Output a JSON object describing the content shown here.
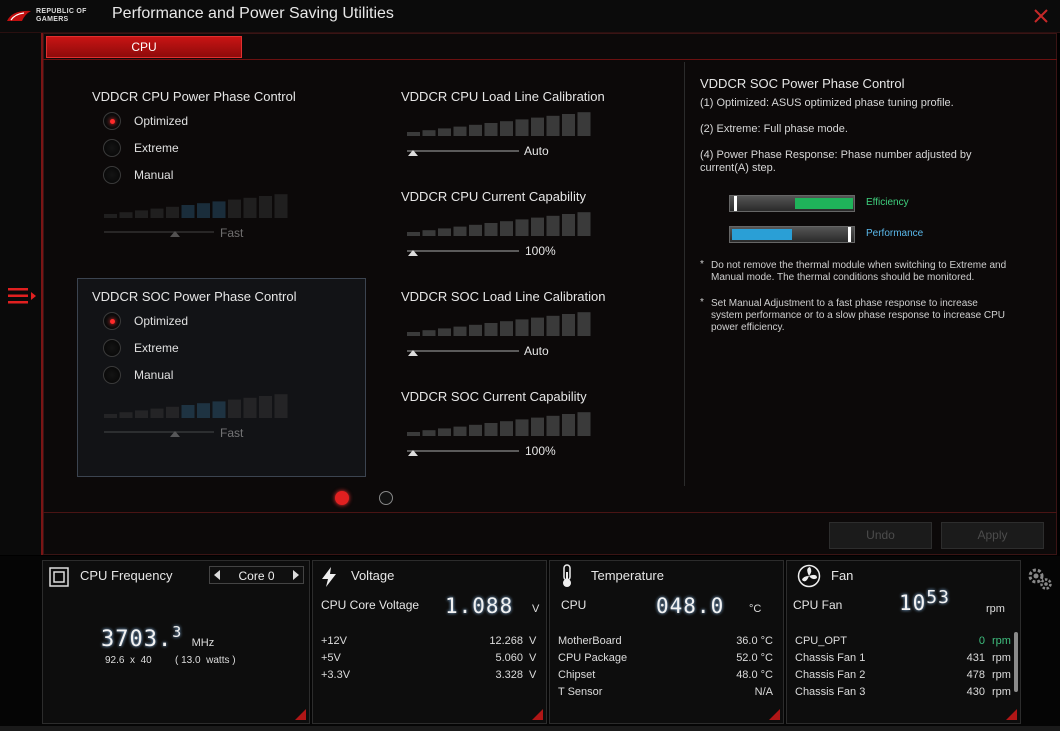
{
  "app": {
    "brand_line1": "REPUBLIC OF",
    "brand_line2": "GAMERS",
    "title": "Performance and Power Saving Utilities"
  },
  "tabs": [
    {
      "label": "CPU"
    }
  ],
  "cpu_phase": {
    "title": "VDDCR CPU Power Phase Control",
    "options": [
      "Optimized",
      "Extreme",
      "Manual"
    ],
    "selected": "Optimized",
    "slider_label": "Fast"
  },
  "soc_phase": {
    "title": "VDDCR SOC Power Phase Control",
    "options": [
      "Optimized",
      "Extreme",
      "Manual"
    ],
    "selected": "Optimized",
    "slider_label": "Fast"
  },
  "sliders": [
    {
      "title": "VDDCR CPU Load Line Calibration",
      "value": "Auto"
    },
    {
      "title": "VDDCR CPU Current Capability",
      "value": "100%"
    },
    {
      "title": "VDDCR SOC Load Line Calibration",
      "value": "Auto"
    },
    {
      "title": "VDDCR SOC Current Capability",
      "value": "100%"
    }
  ],
  "help": {
    "title": "VDDCR SOC Power Phase Control",
    "line1": "(1) Optimized: ASUS optimized phase tuning profile.",
    "line2": "(2) Extreme: Full phase mode.",
    "line3a": "(4) Power Phase Response: Phase number adjusted by",
    "line3b": "current(A) step.",
    "efficiency_label": "Efficiency",
    "performance_label": "Performance",
    "efficiency_color": "#1fb35a",
    "performance_color": "#2a9fd6",
    "note1a": "Do not remove the thermal module when switching to Extreme and",
    "note1b": "Manual mode. The thermal conditions should be monitored.",
    "note2a": "Set Manual Adjustment to a fast phase response to increase",
    "note2b": "system performance or to a slow phase response to increase CPU",
    "note2c": "power efficiency."
  },
  "buttons": {
    "undo": "Undo",
    "apply": "Apply"
  },
  "monitor": {
    "cpu": {
      "title": "CPU Frequency",
      "core": "Core 0",
      "freq_main": "3703.",
      "freq_frac": "3",
      "freq_unit": "MHz",
      "ratio": "92.6  x  40",
      "watts": "( 13.0  watts )"
    },
    "voltage": {
      "title": "Voltage",
      "core_label": "CPU Core Voltage",
      "core_value": "1.088",
      "core_unit": "V",
      "rows": [
        {
          "label": "+12V",
          "value": "12.268",
          "unit": "V"
        },
        {
          "label": "+5V",
          "value": "5.060",
          "unit": "V"
        },
        {
          "label": "+3.3V",
          "value": "3.328",
          "unit": "V"
        }
      ]
    },
    "temperature": {
      "title": "Temperature",
      "cpu_label": "CPU",
      "cpu_value": "048.0",
      "cpu_unit": "°C",
      "rows": [
        {
          "label": "MotherBoard",
          "value": "36.0 °C"
        },
        {
          "label": "CPU Package",
          "value": "52.0 °C"
        },
        {
          "label": "Chipset",
          "value": "48.0 °C"
        },
        {
          "label": "T Sensor",
          "value": "N/A"
        }
      ]
    },
    "fan": {
      "title": "Fan",
      "cpu_label": "CPU Fan",
      "cpu_value_main": "10",
      "cpu_value_sup": "53",
      "cpu_unit": "rpm",
      "rows": [
        {
          "label": "CPU_OPT",
          "value": "0",
          "unit": "rpm",
          "color": "#3fbf7f"
        },
        {
          "label": "Chassis Fan 1",
          "value": "431",
          "unit": "rpm"
        },
        {
          "label": "Chassis Fan 2",
          "value": "478",
          "unit": "rpm"
        },
        {
          "label": "Chassis Fan 3",
          "value": "430",
          "unit": "rpm"
        }
      ]
    }
  },
  "colors": {
    "accent": "#c81414"
  }
}
